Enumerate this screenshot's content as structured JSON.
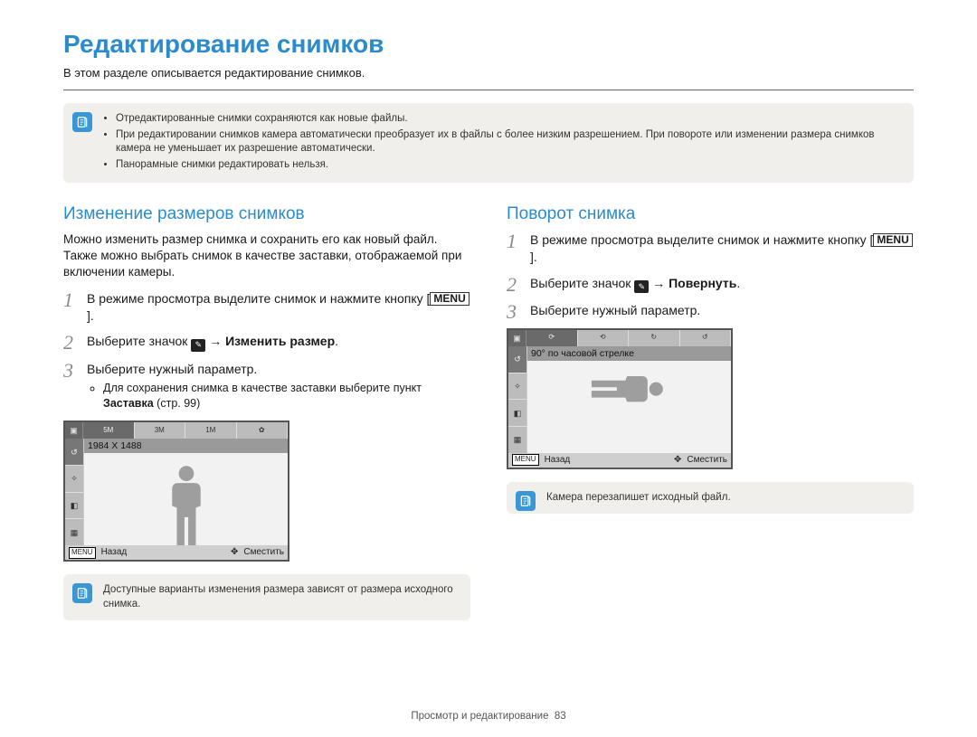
{
  "title": "Редактирование снимков",
  "subtitle": "В этом разделе описывается редактирование снимков.",
  "top_note_items": [
    "Отредактированные снимки сохраняются как новые файлы.",
    "При редактировании снимков камера автоматически преобразует их в файлы с более низким разрешением. При повороте или изменении размера снимков камера не уменьшает их разрешение автоматически.",
    "Панорамные снимки редактировать нельзя."
  ],
  "left": {
    "heading": "Изменение размеров снимков",
    "intro": "Можно изменить размер снимка и сохранить его как новый файл. Также можно выбрать снимок в качестве заставки, отображаемой при включении камеры.",
    "step1_a": "В режиме просмотра выделите снимок и нажмите кнопку [",
    "step1_key": "MENU",
    "step1_b": "].",
    "step2_a": "Выберите значок ",
    "step2_arrow": " → ",
    "step2_bold": "Изменить размер",
    "step2_b": ".",
    "step3": "Выберите нужный параметр.",
    "bullet_a": "Для сохранения снимка в качестве заставки выберите пункт ",
    "bullet_bold": "Заставка",
    "bullet_b": " (стр. 99)",
    "screen_label": "1984 X 1488",
    "screen_back": "Назад",
    "screen_move": "Сместить",
    "note": "Доступные варианты изменения размера зависят от размера исходного снимка."
  },
  "right": {
    "heading": "Поворот снимка",
    "step1_a": "В режиме просмотра выделите снимок и нажмите кнопку [",
    "step1_key": "MENU",
    "step1_b": "].",
    "step2_a": "Выберите значок ",
    "step2_arrow": " → ",
    "step2_bold": "Повернуть",
    "step2_b": ".",
    "step3": "Выберите нужный параметр.",
    "screen_label": "90° по часовой стрелке",
    "screen_back": "Назад",
    "screen_move": "Сместить",
    "note": "Камера перезапишет исходный файл."
  },
  "footer_section": "Просмотр и редактирование",
  "footer_page": "83",
  "menu_key_text": "MENU"
}
